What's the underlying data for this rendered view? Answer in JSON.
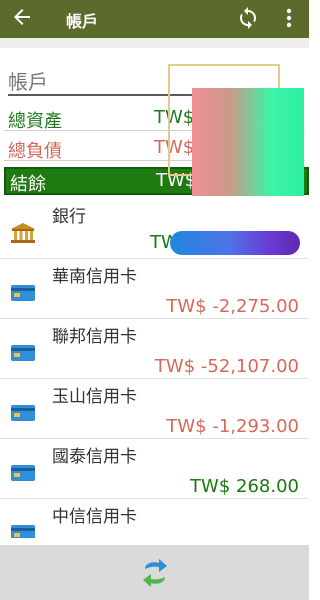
{
  "appbar": {
    "title": "帳戶",
    "back_icon": "arrow-left-icon",
    "sync_icon": "sync-icon",
    "more_icon": "more-vert-icon",
    "color": "#5b6b2b"
  },
  "summary": {
    "title": "帳戶",
    "rows": [
      {
        "label": "總資產",
        "currency": "TW$"
      },
      {
        "label": "總負債",
        "currency": "TW$"
      },
      {
        "label": "結餘",
        "currency": "TW$"
      }
    ]
  },
  "accounts": [
    {
      "name": "銀行",
      "amount": "TW",
      "icon": "bank-icon"
    },
    {
      "name": "華南信用卡",
      "amount": "TW$ -2,275.00",
      "icon": "credit-card-icon"
    },
    {
      "name": "聯邦信用卡",
      "amount": "TW$ -52,107.00",
      "icon": "credit-card-icon"
    },
    {
      "name": "玉山信用卡",
      "amount": "TW$ -1,293.00",
      "icon": "credit-card-icon"
    },
    {
      "name": "國泰信用卡",
      "amount": "TW$ 268.00",
      "icon": "credit-card-icon"
    },
    {
      "name": "中信信用卡",
      "amount": "",
      "icon": "credit-card-icon"
    }
  ],
  "bottombar": {
    "swap_icon": "swap-arrows-icon"
  },
  "colors": {
    "positive": "#1a7a12",
    "negative": "#d46a5a",
    "balance_bg": "#1f7a12"
  }
}
